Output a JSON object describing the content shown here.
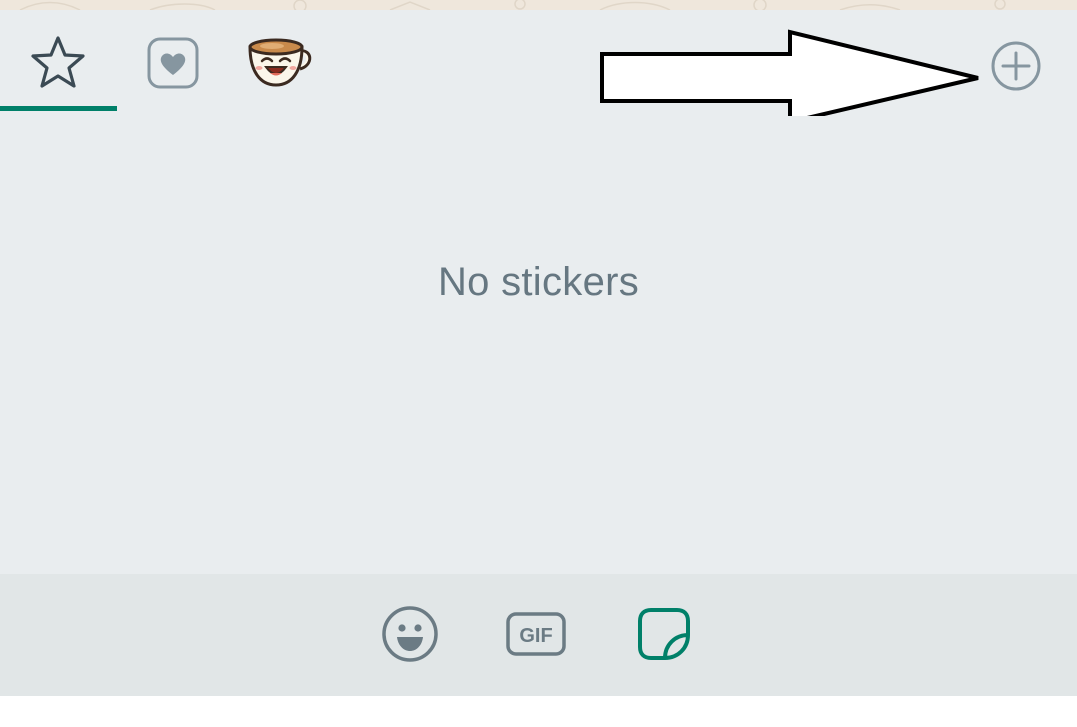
{
  "tabs": [
    {
      "name": "favorites",
      "icon": "star-icon",
      "selected": true
    },
    {
      "name": "heart-pack",
      "icon": "heart-icon",
      "selected": false
    },
    {
      "name": "coffee-pack",
      "icon": "coffee-cup-sticker-icon",
      "selected": false
    }
  ],
  "add_button": {
    "icon": "plus-circle-icon"
  },
  "annotation": {
    "icon": "arrow-right-icon"
  },
  "empty_state": {
    "text": "No stickers"
  },
  "bottom_bar": {
    "emoji": {
      "icon": "smiley-icon"
    },
    "gif": {
      "icon": "gif-icon",
      "label": "GIF"
    },
    "sticker": {
      "icon": "sticker-icon",
      "selected": true
    }
  },
  "colors": {
    "accent": "#008069",
    "panel_bg": "#e9edef",
    "bottom_bar_bg": "#e1e6e7",
    "text_muted": "#667781",
    "icon_gray": "#8696a0"
  }
}
